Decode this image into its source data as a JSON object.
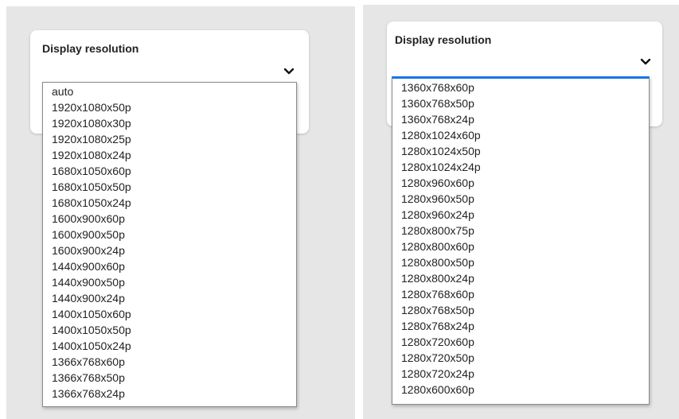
{
  "left": {
    "title": "Display resolution",
    "options": [
      "auto",
      "1920x1080x50p",
      "1920x1080x30p",
      "1920x1080x25p",
      "1920x1080x24p",
      "1680x1050x60p",
      "1680x1050x50p",
      "1680x1050x24p",
      "1600x900x60p",
      "1600x900x50p",
      "1600x900x24p",
      "1440x900x60p",
      "1440x900x50p",
      "1440x900x24p",
      "1400x1050x60p",
      "1400x1050x50p",
      "1400x1050x24p",
      "1366x768x60p",
      "1366x768x50p",
      "1366x768x24p"
    ]
  },
  "right": {
    "title": "Display resolution",
    "options": [
      "1360x768x60p",
      "1360x768x50p",
      "1360x768x24p",
      "1280x1024x60p",
      "1280x1024x50p",
      "1280x1024x24p",
      "1280x960x60p",
      "1280x960x50p",
      "1280x960x24p",
      "1280x800x75p",
      "1280x800x60p",
      "1280x800x50p",
      "1280x800x24p",
      "1280x768x60p",
      "1280x768x50p",
      "1280x768x24p",
      "1280x720x60p",
      "1280x720x50p",
      "1280x720x24p",
      "1280x600x60p"
    ]
  },
  "icons": {
    "chevron": "chevron-down-icon"
  },
  "colors": {
    "panel_background": "#e6e6e6",
    "focus_accent": "#1a73e8"
  }
}
